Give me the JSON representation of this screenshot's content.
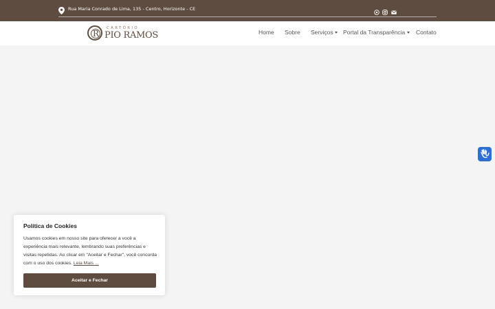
{
  "topbar": {
    "address": "Rua Maria Conrado de Lima, 135 - Centro, Horizonte - CE",
    "icons": [
      "map-marker-icon",
      "whatsapp-icon",
      "instagram-icon",
      "envelope-icon"
    ],
    "background": "#5f4c40"
  },
  "logo": {
    "monogram": "R",
    "top_text": "CARTÓRIO",
    "name": "PIO RAMOS"
  },
  "nav": {
    "items": [
      {
        "label": "Home"
      },
      {
        "label": "Sobre"
      },
      {
        "label": "Serviços"
      },
      {
        "label": "Portal da Transparência"
      },
      {
        "label": "Contato"
      }
    ]
  },
  "accessibility": {
    "icon": "sign-language-hands-icon",
    "color": "#2f6fd3"
  },
  "cookie": {
    "title": "Política de Cookies",
    "text": "Usamos cookies em nosso site para oferecer a você a experiência mais relevante, lembrando suas preferências e visitas repetidas. Ao clicar em \"Aceitar e Fechar\", você concorda com o uso dos cookies.",
    "link": "Leia Mais ...",
    "button": "Aceitar e Fechar"
  },
  "colors": {
    "brand": "#5f4c40",
    "page_bg": "#f4f4f5"
  }
}
